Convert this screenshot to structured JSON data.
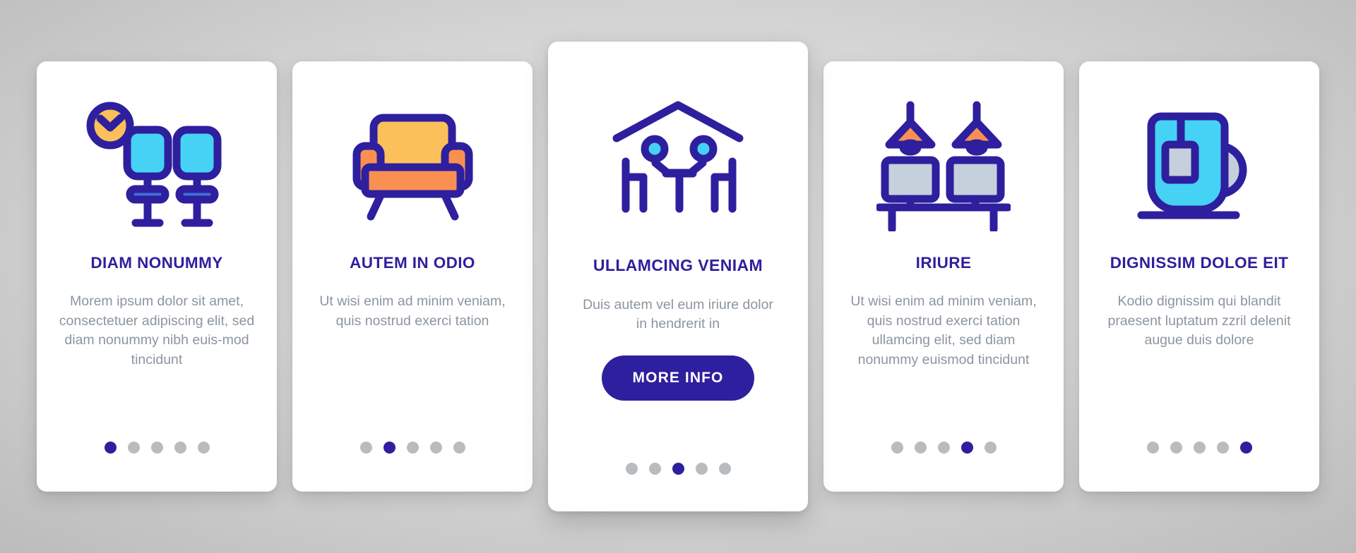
{
  "page": {
    "background_color": "#d4d4d4",
    "accent_color": "#2e1f9e",
    "body_text_color": "#8b95a1",
    "dot_inactive_color": "#b9bcbf",
    "icon_cyan": "#45d2f5",
    "icon_yellow": "#fbc05a",
    "icon_orange": "#f99052",
    "icon_gray": "#c5d0dc"
  },
  "cards": [
    {
      "icon_name": "clock-and-bar-stools-icon",
      "title": "DIAM NONUMMY",
      "description": "Morem ipsum dolor sit amet, consectetuer adipiscing elit, sed diam nonummy nibh euis-mod tincidunt",
      "featured": false,
      "button_label": null,
      "dots": {
        "count": 5,
        "active_index": 0
      }
    },
    {
      "icon_name": "armchair-icon",
      "title": "AUTEM IN ODIO",
      "description": "Ut wisi enim ad minim veniam, quis nostrud exerci tation",
      "featured": false,
      "button_label": null,
      "dots": {
        "count": 5,
        "active_index": 1
      }
    },
    {
      "icon_name": "people-dining-under-roof-icon",
      "title": "ULLAMCING VENIAM",
      "description": "Duis autem vel eum iriure dolor in hendrerit in",
      "featured": true,
      "button_label": "MORE INFO",
      "dots": {
        "count": 5,
        "active_index": 2
      }
    },
    {
      "icon_name": "pendant-lamps-and-monitors-desk-icon",
      "title": "IRIURE",
      "description": "Ut wisi enim ad minim veniam, quis nostrud exerci tation ullamcing elit, sed diam nonummy euismod tincidunt",
      "featured": false,
      "button_label": null,
      "dots": {
        "count": 5,
        "active_index": 3
      }
    },
    {
      "icon_name": "tea-mug-icon",
      "title": "DIGNISSIM DOLOE EIT",
      "description": "Kodio dignissim qui blandit praesent luptatum zzril delenit augue duis dolore",
      "featured": false,
      "button_label": null,
      "dots": {
        "count": 5,
        "active_index": 4
      }
    }
  ]
}
